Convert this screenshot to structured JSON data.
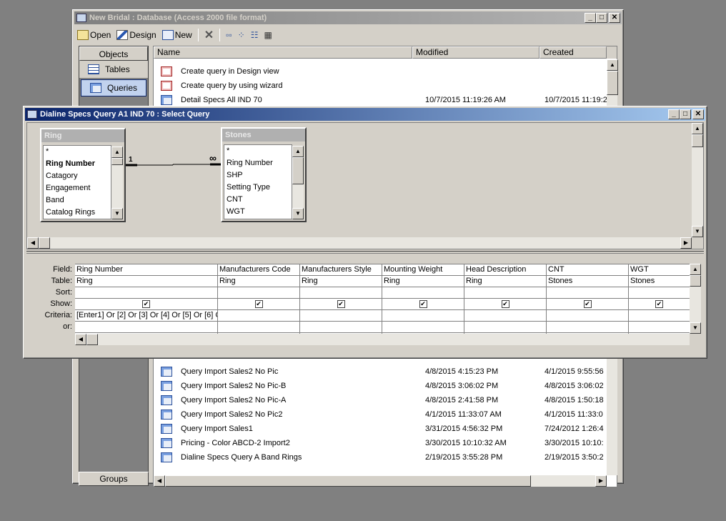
{
  "db_window": {
    "title": "New Bridal : Database (Access 2000 file format)",
    "toolbar": {
      "open": "Open",
      "design": "Design",
      "new": "New"
    },
    "objects": {
      "header": "Objects",
      "items": [
        "Tables",
        "Queries"
      ],
      "groups": "Groups"
    },
    "list": {
      "headers": {
        "name": "Name",
        "modified": "Modified",
        "created": "Created"
      },
      "top_items": [
        {
          "name": "Create query in Design view",
          "modified": "",
          "created": ""
        },
        {
          "name": "Create query by using wizard",
          "modified": "",
          "created": ""
        },
        {
          "name": "Detail Specs All IND 70",
          "modified": "10/7/2015 11:19:26 AM",
          "created": "10/7/2015 11:19:2"
        }
      ],
      "bottom_items": [
        {
          "name": "Query Import Sales2 No Pic",
          "modified": "4/8/2015 4:15:23 PM",
          "created": "4/1/2015 9:55:56"
        },
        {
          "name": "Query Import Sales2 No Pic-B",
          "modified": "4/8/2015 3:06:02 PM",
          "created": "4/8/2015 3:06:02"
        },
        {
          "name": "Query Import Sales2 No Pic-A",
          "modified": "4/8/2015 2:41:58 PM",
          "created": "4/8/2015 1:50:18"
        },
        {
          "name": "Query Import Sales2 No Pic2",
          "modified": "4/1/2015 11:33:07 AM",
          "created": "4/1/2015 11:33:0"
        },
        {
          "name": "Query Import Sales1",
          "modified": "3/31/2015 4:56:32 PM",
          "created": "7/24/2012 1:26:4"
        },
        {
          "name": "Pricing - Color ABCD-2 Import2",
          "modified": "3/30/2015 10:10:32 AM",
          "created": "3/30/2015 10:10:"
        },
        {
          "name": "Dialine Specs Query A Band Rings",
          "modified": "2/19/2015 3:55:28 PM",
          "created": "2/19/2015 3:50:2"
        }
      ]
    }
  },
  "query_window": {
    "title": "Dialine Specs Query A1 IND 70 : Select Query",
    "tables": [
      {
        "title": "Ring",
        "fields": [
          "*",
          "Ring Number",
          "Catagory",
          "Engagement",
          "Band",
          "Catalog Rings"
        ],
        "key_field": "Ring Number"
      },
      {
        "title": "Stones",
        "fields": [
          "*",
          "Ring Number",
          "SHP",
          "Setting Type",
          "CNT",
          "WGT"
        ]
      }
    ],
    "relationship": {
      "one": "1",
      "many": "∞"
    },
    "grid_labels": [
      "Field:",
      "Table:",
      "Sort:",
      "Show:",
      "Criteria:",
      "or:"
    ],
    "columns": [
      {
        "field": "Ring Number",
        "table": "Ring",
        "show": true,
        "criteria": "[Enter1] Or [2] Or [3] Or [4] Or [5] Or [6] C"
      },
      {
        "field": "Manufacturers Code",
        "table": "Ring",
        "show": true,
        "criteria": ""
      },
      {
        "field": "Manufacturers Style",
        "table": "Ring",
        "show": true,
        "criteria": ""
      },
      {
        "field": "Mounting Weight",
        "table": "Ring",
        "show": true,
        "criteria": ""
      },
      {
        "field": "Head Description",
        "table": "Ring",
        "show": true,
        "criteria": ""
      },
      {
        "field": "CNT",
        "table": "Stones",
        "show": true,
        "criteria": ""
      },
      {
        "field": "WGT",
        "table": "Stones",
        "show": true,
        "criteria": ""
      }
    ]
  }
}
